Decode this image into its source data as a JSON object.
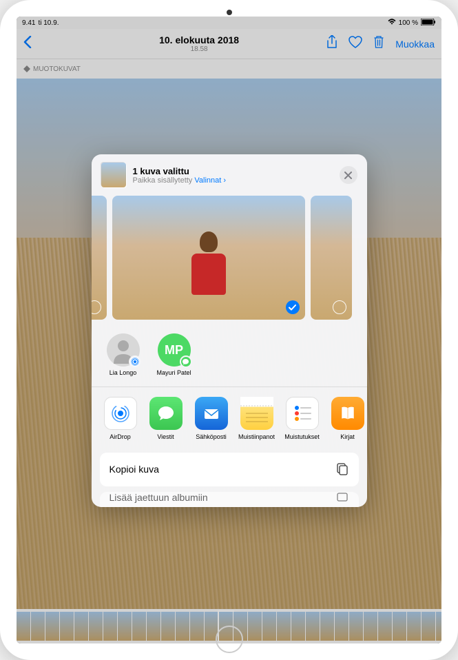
{
  "status": {
    "time": "9.41",
    "date": "ti 10.9.",
    "battery": "100 %",
    "wifi": true
  },
  "nav": {
    "title": "10. elokuuta 2018",
    "subtitle": "18.58",
    "edit": "Muokkaa"
  },
  "badge": {
    "label": "MUOTOKUVAT"
  },
  "sheet": {
    "title": "1 kuva valittu",
    "subtitle_prefix": "Paikka sisällytetty",
    "options_link": "Valinnat",
    "contacts": [
      {
        "name": "Lia Longo",
        "initials": "",
        "avatar_bg": "#d8d8d8",
        "badge_type": "airdrop"
      },
      {
        "name": "Mayuri Patel",
        "initials": "MP",
        "avatar_bg": "#4cd964",
        "badge_type": "messages"
      }
    ],
    "apps": [
      {
        "name": "AirDrop",
        "bg": "#ffffff",
        "icon": "airdrop"
      },
      {
        "name": "Viestit",
        "bg": "#4cd964",
        "icon": "messages"
      },
      {
        "name": "Sähköposti",
        "bg": "#1e88e5",
        "icon": "mail"
      },
      {
        "name": "Muistiinpanot",
        "bg": "#ffe27a",
        "icon": "notes"
      },
      {
        "name": "Muistutukset",
        "bg": "#ffffff",
        "icon": "reminders"
      },
      {
        "name": "Kirjat",
        "bg": "#ff9500",
        "icon": "books"
      }
    ],
    "actions": [
      {
        "label": "Kopioi kuva",
        "icon": "copy"
      },
      {
        "label": "Lisää jaettuun albumiin",
        "icon": "album"
      }
    ]
  }
}
